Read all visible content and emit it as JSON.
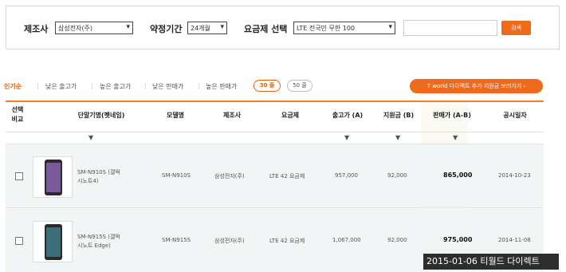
{
  "filters": {
    "maker_label": "제조사",
    "maker_value": "삼성전자(주)",
    "contract_label": "약정기간",
    "contract_value": "24개월",
    "plan_label": "요금제 선택",
    "plan_value": "LTE 전국민 무한 100",
    "search_input": "",
    "search_button": "검색"
  },
  "sort": {
    "options": [
      "인기순",
      "낮은 출고가",
      "높은 출고가",
      "낮은 판매가",
      "높은 판매가"
    ],
    "active": "인기순",
    "page_sizes": [
      "30 줄",
      "50 줄"
    ],
    "active_page_size": "30 줄",
    "tworld_button": "T world 다이렉트 추가 지원금 보러가기 ›"
  },
  "table": {
    "headers": {
      "select": "선택\n비교",
      "model_name": "단말기명(펫네임)",
      "model": "모델명",
      "maker": "제조사",
      "plan": "요금제",
      "msrp": "출고가 (A)",
      "subsidy": "지원금 (B)",
      "price": "판매가 (A-B)",
      "date": "공시일자"
    },
    "sort_arrow": "▼",
    "rows": [
      {
        "name_line1": "SM-N910S (갤럭",
        "name_line2": "시노트4)",
        "model": "SM-N910S",
        "maker": "삼성전자(주)",
        "plan": "LTE 42 요금제",
        "msrp": "957,000",
        "subsidy": "92,000",
        "price": "865,000",
        "date": "2014-10-23",
        "screen_color": "#7a5a9a"
      },
      {
        "name_line1": "SM-N915S (갤럭",
        "name_line2": "시노트 Edge)",
        "model": "SM-N915S",
        "maker": "삼성전자(주)",
        "plan": "LTE 42 요금제",
        "msrp": "1,067,000",
        "subsidy": "92,000",
        "price": "975,000",
        "date": "2014-11-08",
        "screen_color": "#3d6f7a"
      }
    ]
  },
  "watermark": "2015-01-06 티월드 다이렉트",
  "colors": {
    "accent": "#ef6a1c",
    "row_bg": "#f2f5f5"
  }
}
